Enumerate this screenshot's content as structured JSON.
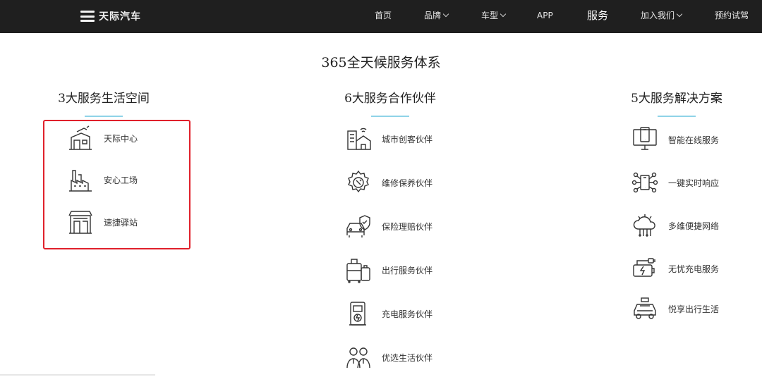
{
  "nav": {
    "brand": "天际汽车",
    "items": [
      {
        "label": "首页",
        "dropdown": false
      },
      {
        "label": "品牌",
        "dropdown": true
      },
      {
        "label": "车型",
        "dropdown": true
      },
      {
        "label": "APP",
        "dropdown": false
      },
      {
        "label": "服务",
        "dropdown": false,
        "active": true
      },
      {
        "label": "加入我们",
        "dropdown": true
      },
      {
        "label": "预约试驾",
        "dropdown": false
      }
    ]
  },
  "main_title": "365全天候服务体系",
  "columns": [
    {
      "title": "3大服务生活空间",
      "items": [
        {
          "label": "天际中心",
          "icon": "building-icon"
        },
        {
          "label": "安心工场",
          "icon": "factory-icon"
        },
        {
          "label": "速捷驿站",
          "icon": "station-icon"
        }
      ]
    },
    {
      "title": "6大服务合作伙伴",
      "items": [
        {
          "label": "城市创客伙伴",
          "icon": "city-house-icon"
        },
        {
          "label": "维修保养伙伴",
          "icon": "gear-wrench-icon"
        },
        {
          "label": "保险理赔伙伴",
          "icon": "car-shield-icon"
        },
        {
          "label": "出行服务伙伴",
          "icon": "luggage-icon"
        },
        {
          "label": "充电服务伙伴",
          "icon": "charging-pile-icon"
        },
        {
          "label": "优选生活伙伴",
          "icon": "people-icon"
        }
      ]
    },
    {
      "title": "5大服务解决方案",
      "items": [
        {
          "label": "智能在线服务",
          "icon": "monitor-phone-icon"
        },
        {
          "label": "一键实时响应",
          "icon": "network-phone-icon"
        },
        {
          "label": "多维便捷网络",
          "icon": "cloud-network-icon"
        },
        {
          "label": "无忧充电服务",
          "icon": "battery-plug-icon"
        },
        {
          "label": "悦享出行生活",
          "icon": "taxi-icon"
        }
      ]
    }
  ],
  "colors": {
    "nav_bg": "#1f1f1f",
    "accent_underline": "#8fd3e8",
    "highlight_border": "#e0202b"
  }
}
